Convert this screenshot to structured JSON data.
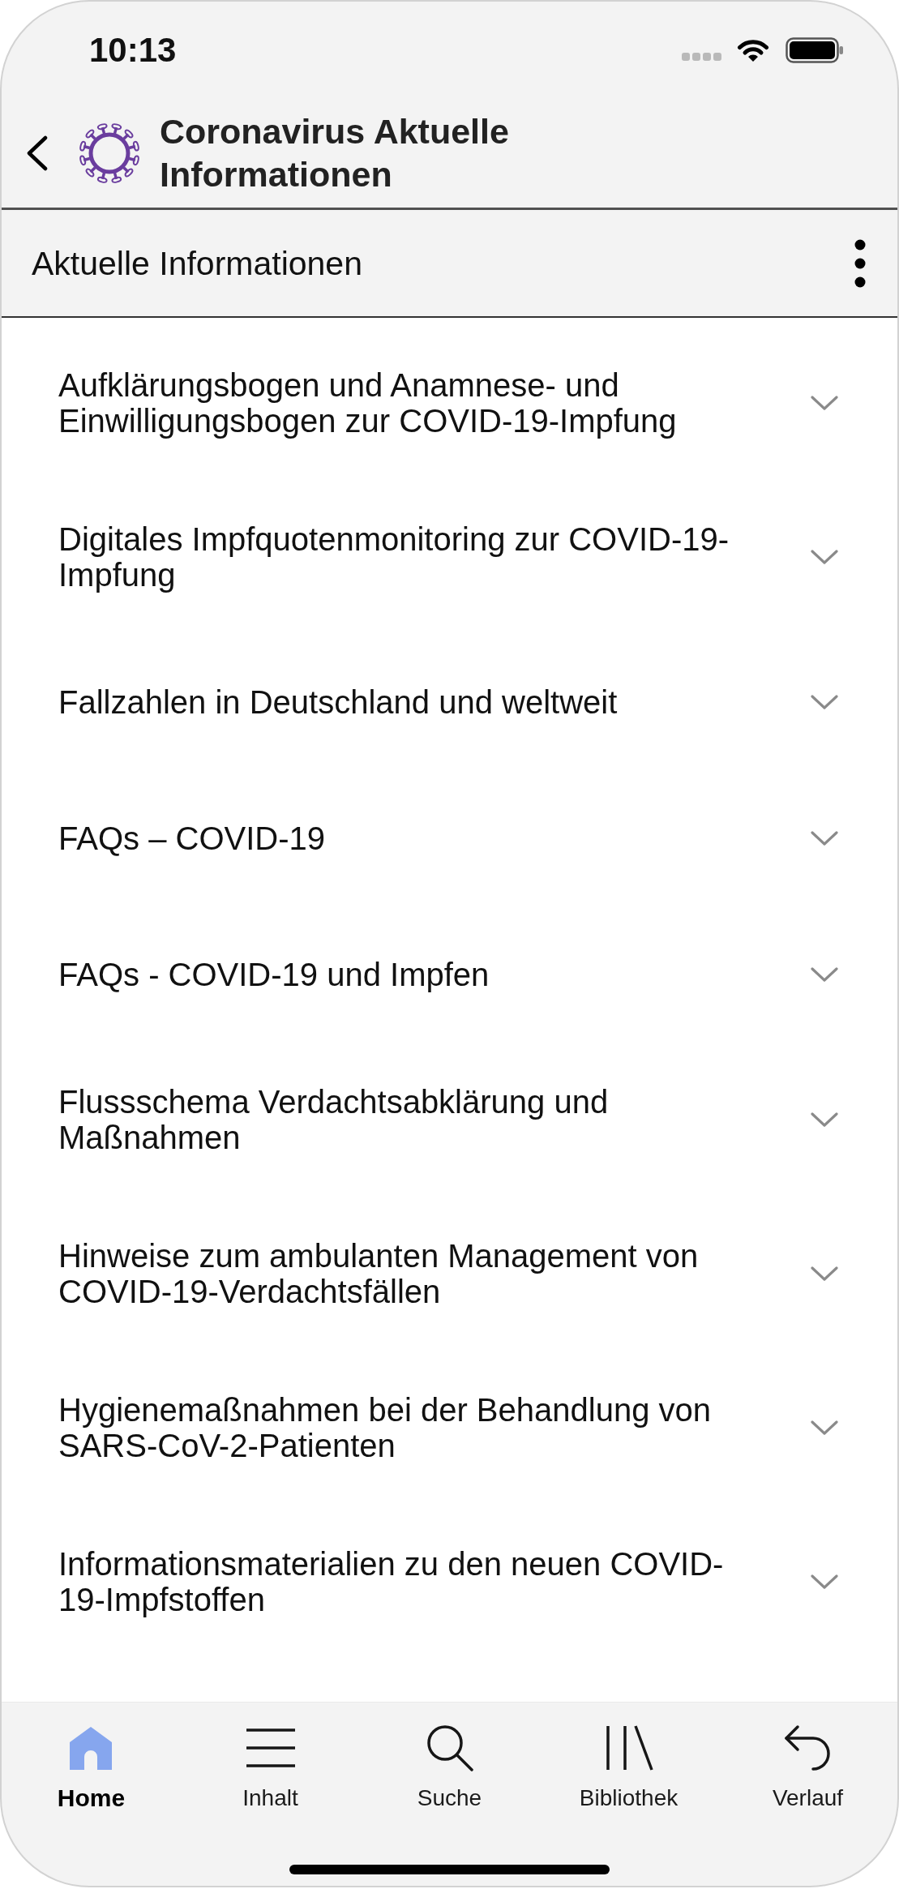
{
  "status_bar": {
    "time": "10:13"
  },
  "header": {
    "title": "Coronavirus Aktuelle Informationen"
  },
  "section": {
    "title": "Aktuelle Informationen"
  },
  "topics": [
    {
      "title": "Aufklärungsbogen und Anamnese- und Einwilligungsbogen zur COVID-19-Impfung",
      "expanded": false
    },
    {
      "title": "Digitales Impfquotenmonitoring zur COVID-19-Impfung",
      "expanded": false
    },
    {
      "title": "Fallzahlen in Deutschland und weltweit",
      "expanded": false
    },
    {
      "title": "FAQs – COVID-19",
      "expanded": false
    },
    {
      "title": "FAQs - COVID-19 und Impfen",
      "expanded": false
    },
    {
      "title": "Flussschema Verdachtsabklärung und Maßnahmen",
      "expanded": false
    },
    {
      "title": "Hinweise zum ambulanten Management von COVID-19-Verdachtsfällen",
      "expanded": false
    },
    {
      "title": "Hygienemaßnahmen bei der Behandlung von SARS-CoV-2-Patienten",
      "expanded": false
    },
    {
      "title": "Informationsmaterialien zu den neuen COVID-19-Impfstoffen",
      "expanded": false
    }
  ],
  "tab_bar": [
    {
      "kind": "home",
      "label": "Home",
      "selected": true
    },
    {
      "kind": "contents",
      "label": "Inhalt",
      "selected": false
    },
    {
      "kind": "search",
      "label": "Suche",
      "selected": false
    },
    {
      "kind": "library",
      "label": "Bibliothek",
      "selected": false
    },
    {
      "kind": "history",
      "label": "Verlauf",
      "selected": false
    }
  ]
}
